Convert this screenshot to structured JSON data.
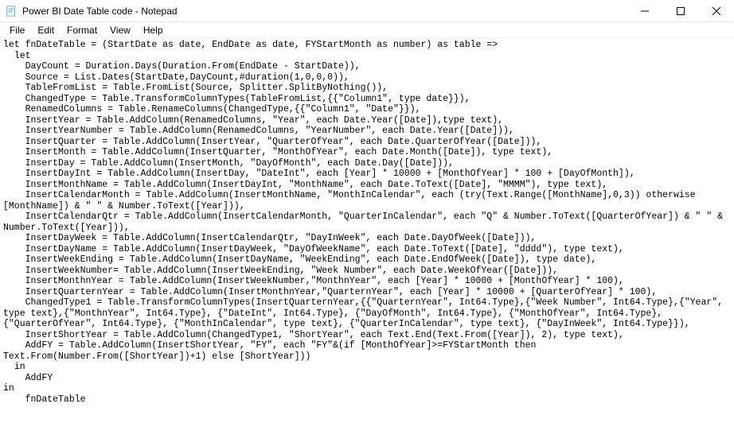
{
  "window": {
    "title": "Power BI Date Table code - Notepad"
  },
  "menu": {
    "file": "File",
    "edit": "Edit",
    "format": "Format",
    "view": "View",
    "help": "Help"
  },
  "editor": {
    "content": "let fnDateTable = (StartDate as date, EndDate as date, FYStartMonth as number) as table =>\n  let\n    DayCount = Duration.Days(Duration.From(EndDate - StartDate)),\n    Source = List.Dates(StartDate,DayCount,#duration(1,0,0,0)),\n    TableFromList = Table.FromList(Source, Splitter.SplitByNothing()),\n    ChangedType = Table.TransformColumnTypes(TableFromList,{{\"Column1\", type date}}),\n    RenamedColumns = Table.RenameColumns(ChangedType,{{\"Column1\", \"Date\"}}),\n    InsertYear = Table.AddColumn(RenamedColumns, \"Year\", each Date.Year([Date]),type text),\n    InsertYearNumber = Table.AddColumn(RenamedColumns, \"YearNumber\", each Date.Year([Date])),\n    InsertQuarter = Table.AddColumn(InsertYear, \"QuarterOfYear\", each Date.QuarterOfYear([Date])),\n    InsertMonth = Table.AddColumn(InsertQuarter, \"MonthOfYear\", each Date.Month([Date]), type text),\n    InsertDay = Table.AddColumn(InsertMonth, \"DayOfMonth\", each Date.Day([Date])),\n    InsertDayInt = Table.AddColumn(InsertDay, \"DateInt\", each [Year] * 10000 + [MonthOfYear] * 100 + [DayOfMonth]),\n    InsertMonthName = Table.AddColumn(InsertDayInt, \"MonthName\", each Date.ToText([Date], \"MMMM\"), type text),\n    InsertCalendarMonth = Table.AddColumn(InsertMonthName, \"MonthInCalendar\", each (try(Text.Range([MonthName],0,3)) otherwise [MonthName]) & \" \" & Number.ToText([Year])),\n    InsertCalendarQtr = Table.AddColumn(InsertCalendarMonth, \"QuarterInCalendar\", each \"Q\" & Number.ToText([QuarterOfYear]) & \" \" & Number.ToText([Year])),\n    InsertDayWeek = Table.AddColumn(InsertCalendarQtr, \"DayInWeek\", each Date.DayOfWeek([Date])),\n    InsertDayName = Table.AddColumn(InsertDayWeek, \"DayOfWeekName\", each Date.ToText([Date], \"dddd\"), type text),\n    InsertWeekEnding = Table.AddColumn(InsertDayName, \"WeekEnding\", each Date.EndOfWeek([Date]), type date),\n    InsertWeekNumber= Table.AddColumn(InsertWeekEnding, \"Week Number\", each Date.WeekOfYear([Date])),\n    InsertMonthnYear = Table.AddColumn(InsertWeekNumber,\"MonthnYear\", each [Year] * 10000 + [MonthOfYear] * 100),\n    InsertQuarternYear = Table.AddColumn(InsertMonthnYear,\"QuarternYear\", each [Year] * 10000 + [QuarterOfYear] * 100),\n    ChangedType1 = Table.TransformColumnTypes(InsertQuarternYear,{{\"QuarternYear\", Int64.Type},{\"Week Number\", Int64.Type},{\"Year\", type text},{\"MonthnYear\", Int64.Type}, {\"DateInt\", Int64.Type}, {\"DayOfMonth\", Int64.Type}, {\"MonthOfYear\", Int64.Type}, {\"QuarterOfYear\", Int64.Type}, {\"MonthInCalendar\", type text}, {\"QuarterInCalendar\", type text}, {\"DayInWeek\", Int64.Type}}),\n    InsertShortYear = Table.AddColumn(ChangedType1, \"ShortYear\", each Text.End(Text.From([Year]), 2), type text),\n    AddFY = Table.AddColumn(InsertShortYear, \"FY\", each \"FY\"&(if [MonthOfYear]>=FYStartMonth then Text.From(Number.From([ShortYear])+1) else [ShortYear]))\n  in\n    AddFY\nin\n    fnDateTable"
  }
}
